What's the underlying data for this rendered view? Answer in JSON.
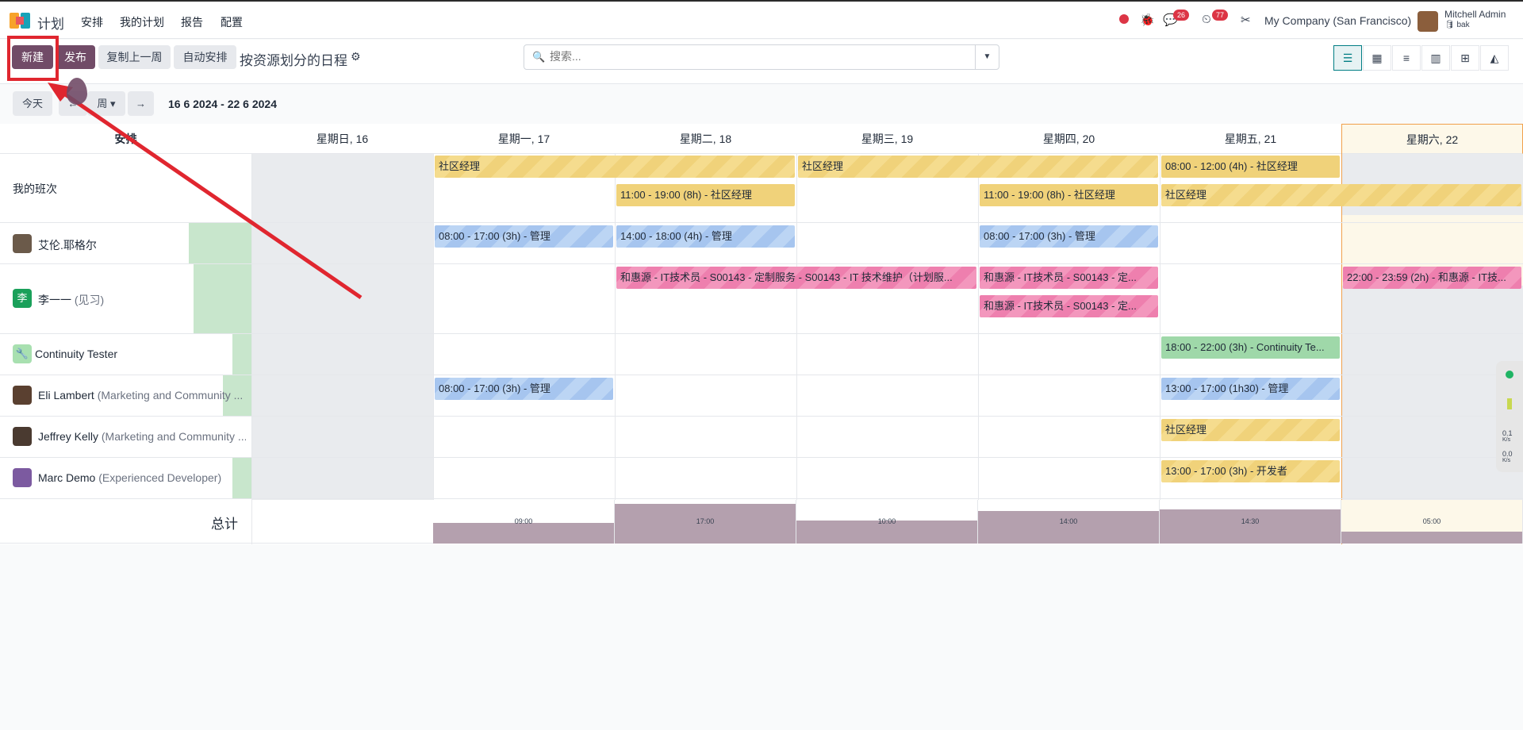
{
  "app": {
    "name": "计划"
  },
  "menu": [
    "安排",
    "我的计划",
    "报告",
    "配置"
  ],
  "notifications": {
    "messages_count": "26",
    "activities_count": "77"
  },
  "company": "My Company (San Francisco)",
  "user": {
    "name": "Mitchell Admin",
    "db": "bak"
  },
  "toolbar": {
    "new_label": "新建",
    "publish_label": "发布",
    "copy_prev_week_label": "复制上一周",
    "auto_plan_label": "自动安排",
    "title": "按资源划分的日程"
  },
  "search": {
    "placeholder": "搜索..."
  },
  "nav": {
    "today_label": "今天",
    "scale_label": "周",
    "date_range": "16 6 2024 - 22 6 2024"
  },
  "grid": {
    "left_header": "安排",
    "days": [
      "星期日, 16",
      "星期一, 17",
      "星期二, 18",
      "星期三, 19",
      "星期四, 20",
      "星期五, 21",
      "星期六, 22"
    ],
    "rows": [
      {
        "name": "我的班次",
        "role": ""
      },
      {
        "name": "艾伦.耶格尔",
        "role": ""
      },
      {
        "name": "李一一",
        "role": "(见习)"
      },
      {
        "name": "Continuity Tester",
        "role": ""
      },
      {
        "name": "Eli Lambert",
        "role": "(Marketing and Community ..."
      },
      {
        "name": "Jeffrey Kelly",
        "role": "(Marketing and Community ..."
      },
      {
        "name": "Marc Demo",
        "role": "(Experienced Developer)"
      }
    ],
    "avatar_initial_li": "李",
    "shifts": {
      "s1": "社区经理",
      "s2": "社区经理",
      "s3": "08:00 - 12:00 (4h) - 社区经理",
      "s4": "11:00 - 19:00 (8h) - 社区经理",
      "s5": "11:00 - 19:00 (8h) - 社区经理",
      "s6": "社区经理",
      "s7": "08:00 - 17:00 (3h) - 管理",
      "s8": "14:00 - 18:00 (4h) - 管理",
      "s9": "08:00 - 17:00 (3h) - 管理",
      "s10": "和惠源 - IT技术员 - S00143 - 定制服务 - S00143 - IT 技术维护（计划服...",
      "s11": "和惠源 - IT技术员 - S00143 - 定...",
      "s12": "和惠源 - IT技术员 - S00143 - 定...",
      "s13": "22:00 - 23:59 (2h) - 和惠源 - IT技...",
      "s14": "18:00 - 22:00 (3h) - Continuity Te...",
      "s15": "08:00 - 17:00 (3h) - 管理",
      "s16": "13:00 - 17:00 (1h30) - 管理",
      "s17": "社区经理",
      "s18": "13:00 - 17:00 (3h) - 开发者"
    },
    "total_label": "总计",
    "totals": [
      "09:00",
      "17:00",
      "10:00",
      "14:00",
      "14:30",
      "05:00"
    ],
    "totals_hours": [
      9,
      17,
      10,
      14,
      14.5,
      5
    ]
  },
  "widget": {
    "v1": "0.1",
    "u1": "K/s",
    "v2": "0.0",
    "u2": "K/s"
  },
  "colors": {
    "primary": "#714b67",
    "accent": "#017e84",
    "annotation": "#e0262f"
  }
}
